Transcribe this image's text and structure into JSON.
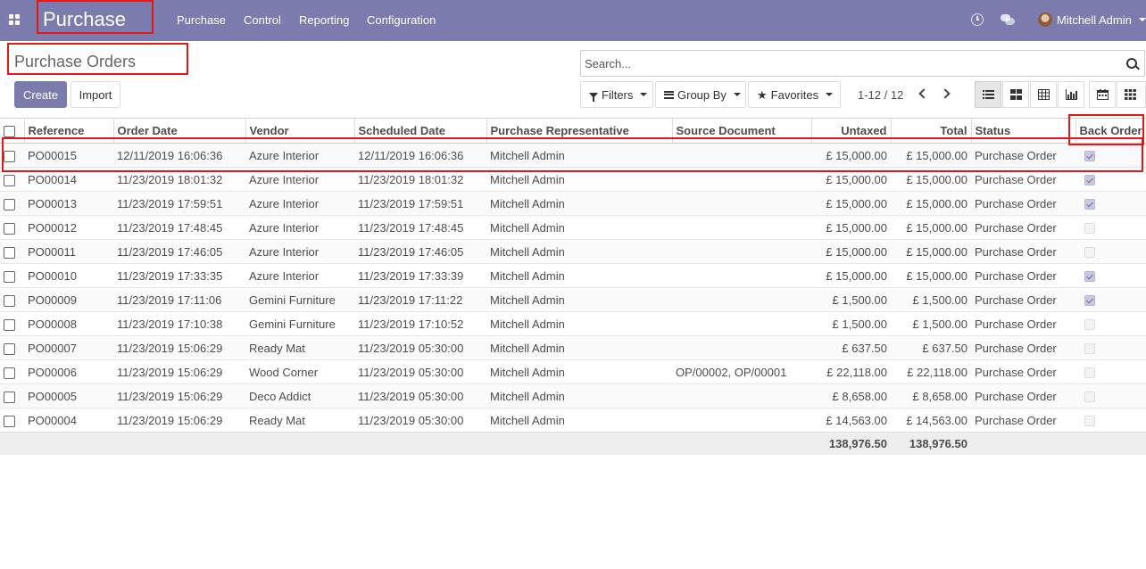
{
  "navbar": {
    "app_title": "Purchase",
    "menu": [
      "Purchase",
      "Control",
      "Reporting",
      "Configuration"
    ],
    "user": "Mitchell Admin",
    "icons": [
      "apps-icon",
      "clock-icon",
      "chat-icon"
    ]
  },
  "control_panel": {
    "page_title": "Purchase Orders",
    "create_label": "Create",
    "import_label": "Import",
    "search_placeholder": "Search...",
    "filters_label": "Filters",
    "group_by_label": "Group By",
    "favorites_label": "Favorites",
    "pager": "1-12 / 12",
    "views": [
      "list-view-icon",
      "kanban-view-icon",
      "pivot-view-icon",
      "graph-view-icon",
      "calendar-view-icon",
      "grid-view-icon"
    ],
    "active_view": "list"
  },
  "table": {
    "columns": [
      "Reference",
      "Order Date",
      "Vendor",
      "Scheduled Date",
      "Purchase Representative",
      "Source Document",
      "Untaxed",
      "Total",
      "Status",
      "Back Order"
    ],
    "rows": [
      {
        "ref": "PO00015",
        "order_date": "12/11/2019 16:06:36",
        "vendor": "Azure Interior",
        "scheduled": "12/11/2019 16:06:36",
        "rep": "Mitchell Admin",
        "source": "",
        "untaxed": "£ 15,000.00",
        "total": "£ 15,000.00",
        "status": "Purchase Order",
        "back_order": true
      },
      {
        "ref": "PO00014",
        "order_date": "11/23/2019 18:01:32",
        "vendor": "Azure Interior",
        "scheduled": "11/23/2019 18:01:32",
        "rep": "Mitchell Admin",
        "source": "",
        "untaxed": "£ 15,000.00",
        "total": "£ 15,000.00",
        "status": "Purchase Order",
        "back_order": true
      },
      {
        "ref": "PO00013",
        "order_date": "11/23/2019 17:59:51",
        "vendor": "Azure Interior",
        "scheduled": "11/23/2019 17:59:51",
        "rep": "Mitchell Admin",
        "source": "",
        "untaxed": "£ 15,000.00",
        "total": "£ 15,000.00",
        "status": "Purchase Order",
        "back_order": true
      },
      {
        "ref": "PO00012",
        "order_date": "11/23/2019 17:48:45",
        "vendor": "Azure Interior",
        "scheduled": "11/23/2019 17:48:45",
        "rep": "Mitchell Admin",
        "source": "",
        "untaxed": "£ 15,000.00",
        "total": "£ 15,000.00",
        "status": "Purchase Order",
        "back_order": false
      },
      {
        "ref": "PO00011",
        "order_date": "11/23/2019 17:46:05",
        "vendor": "Azure Interior",
        "scheduled": "11/23/2019 17:46:05",
        "rep": "Mitchell Admin",
        "source": "",
        "untaxed": "£ 15,000.00",
        "total": "£ 15,000.00",
        "status": "Purchase Order",
        "back_order": false
      },
      {
        "ref": "PO00010",
        "order_date": "11/23/2019 17:33:35",
        "vendor": "Azure Interior",
        "scheduled": "11/23/2019 17:33:39",
        "rep": "Mitchell Admin",
        "source": "",
        "untaxed": "£ 15,000.00",
        "total": "£ 15,000.00",
        "status": "Purchase Order",
        "back_order": true
      },
      {
        "ref": "PO00009",
        "order_date": "11/23/2019 17:11:06",
        "vendor": "Gemini Furniture",
        "scheduled": "11/23/2019 17:11:22",
        "rep": "Mitchell Admin",
        "source": "",
        "untaxed": "£ 1,500.00",
        "total": "£ 1,500.00",
        "status": "Purchase Order",
        "back_order": true
      },
      {
        "ref": "PO00008",
        "order_date": "11/23/2019 17:10:38",
        "vendor": "Gemini Furniture",
        "scheduled": "11/23/2019 17:10:52",
        "rep": "Mitchell Admin",
        "source": "",
        "untaxed": "£ 1,500.00",
        "total": "£ 1,500.00",
        "status": "Purchase Order",
        "back_order": false
      },
      {
        "ref": "PO00007",
        "order_date": "11/23/2019 15:06:29",
        "vendor": "Ready Mat",
        "scheduled": "11/23/2019 05:30:00",
        "rep": "Mitchell Admin",
        "source": "",
        "untaxed": "£ 637.50",
        "total": "£ 637.50",
        "status": "Purchase Order",
        "back_order": false
      },
      {
        "ref": "PO00006",
        "order_date": "11/23/2019 15:06:29",
        "vendor": "Wood Corner",
        "scheduled": "11/23/2019 05:30:00",
        "rep": "Mitchell Admin",
        "source": "OP/00002, OP/00001",
        "untaxed": "£ 22,118.00",
        "total": "£ 22,118.00",
        "status": "Purchase Order",
        "back_order": false
      },
      {
        "ref": "PO00005",
        "order_date": "11/23/2019 15:06:29",
        "vendor": "Deco Addict",
        "scheduled": "11/23/2019 05:30:00",
        "rep": "Mitchell Admin",
        "source": "",
        "untaxed": "£ 8,658.00",
        "total": "£ 8,658.00",
        "status": "Purchase Order",
        "back_order": false
      },
      {
        "ref": "PO00004",
        "order_date": "11/23/2019 15:06:29",
        "vendor": "Ready Mat",
        "scheduled": "11/23/2019 05:30:00",
        "rep": "Mitchell Admin",
        "source": "",
        "untaxed": "£ 14,563.00",
        "total": "£ 14,563.00",
        "status": "Purchase Order",
        "back_order": false
      }
    ],
    "totals": {
      "untaxed": "138,976.50",
      "total": "138,976.50"
    }
  },
  "colors": {
    "brand": "#7c7bad",
    "annotation": "#e0191d"
  }
}
